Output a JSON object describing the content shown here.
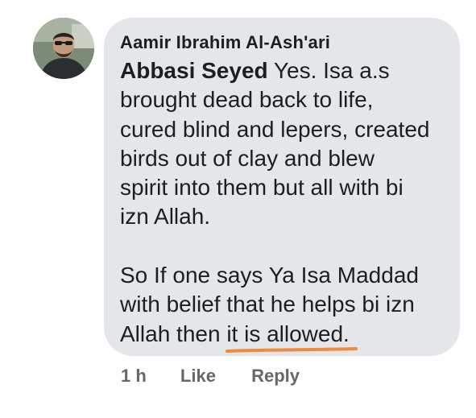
{
  "comment": {
    "author": "Aamir Ibrahim Al-Ash'ari",
    "mention": "Abbasi Seyed",
    "first_line_rest": " Yes. Isa a.s",
    "lines": [
      "brought dead back to life,",
      "cured blind and lepers, created",
      "birds out of clay and blew",
      "spirit into them but all with bi",
      "izn Allah."
    ],
    "paragraph2_lines": [
      "So If one says Ya Isa Maddad",
      "with belief that he helps bi izn",
      "Allah then it is allowed."
    ],
    "highlight_color": "#f08a3c"
  },
  "actions": {
    "time": "1 h",
    "like": "Like",
    "reply": "Reply"
  }
}
